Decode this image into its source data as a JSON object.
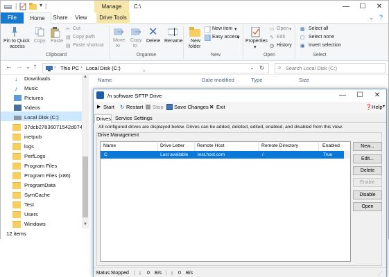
{
  "explorer": {
    "title_path": "C:\\",
    "manage_label": "Manage",
    "tabs": [
      "File",
      "Home",
      "Share",
      "View",
      "Drive Tools"
    ],
    "ribbon": {
      "pin_label_1": "Pin to Quick",
      "pin_label_2": "access",
      "copy_label": "Copy",
      "paste_label": "Paste",
      "cut_label": "Cut",
      "copy_path_label": "Copy path",
      "paste_shortcut_label": "Paste shortcut",
      "move_to_label": "Move",
      "move_to_label2": "to",
      "copy_to_label": "Copy",
      "copy_to_label2": "to",
      "delete_label": "Delete",
      "rename_label": "Rename",
      "new_folder_label": "New",
      "new_folder_label2": "folder",
      "new_item_label": "New item",
      "easy_access_label": "Easy access",
      "properties_label": "Properties",
      "open_label": "Open",
      "edit_label": "Edit",
      "history_label": "History",
      "select_all_label": "Select all",
      "select_none_label": "Select none",
      "invert_selection_label": "Invert selection",
      "groups": [
        "Clipboard",
        "Organise",
        "New",
        "Open",
        "Select"
      ]
    },
    "address": {
      "this_pc": "This PC",
      "local_disk": "Local Disk (C:)",
      "search_placeholder": "Search Local Disk (C:)"
    },
    "nav_items": [
      {
        "label": "Downloads"
      },
      {
        "label": "Music"
      },
      {
        "label": "Pictures"
      },
      {
        "label": "Videos"
      },
      {
        "label": "Local Disk (C:)"
      },
      {
        "label": "37dcb27836071542d0745d"
      },
      {
        "label": "inetpub"
      },
      {
        "label": "logs"
      },
      {
        "label": "PerfLogs"
      },
      {
        "label": "Program Files"
      },
      {
        "label": "Program Files (x86)"
      },
      {
        "label": "ProgramData"
      },
      {
        "label": "SymCache"
      },
      {
        "label": "Test"
      },
      {
        "label": "Users"
      },
      {
        "label": "Windows"
      }
    ],
    "columns": [
      "Name",
      "Date modified",
      "Type",
      "Size"
    ],
    "status": "12 items"
  },
  "sftp": {
    "title": "/n software SFTP Drive",
    "toolbar": {
      "start": "Start",
      "restart": "Restart",
      "stop": "Stop",
      "save": "Save Changes",
      "exit": "Exit",
      "help": "Help"
    },
    "tabs": [
      "Drives",
      "Service",
      "Settings"
    ],
    "description": "All configured drives are displayed below. Drives can be added, deleted, edited, enabled, and disabled from this view.",
    "group_label": "Drive Management",
    "columns": [
      "Name",
      "Drive Letter",
      "Remote Host",
      "Remote Directory",
      "Enabled"
    ],
    "rows": [
      {
        "name": "C",
        "letter": "Last available",
        "host": "test.host.com",
        "dir": "/",
        "enabled": "True"
      }
    ],
    "buttons": {
      "new": "New...",
      "edit": "Edit...",
      "delete": "Delete",
      "enable": "Enable",
      "disable": "Disable",
      "open": "Open"
    },
    "status": {
      "label": "Status:Stopped",
      "down": "0",
      "down_unit": "B/s",
      "up": "0",
      "up_unit": "B/s"
    }
  }
}
